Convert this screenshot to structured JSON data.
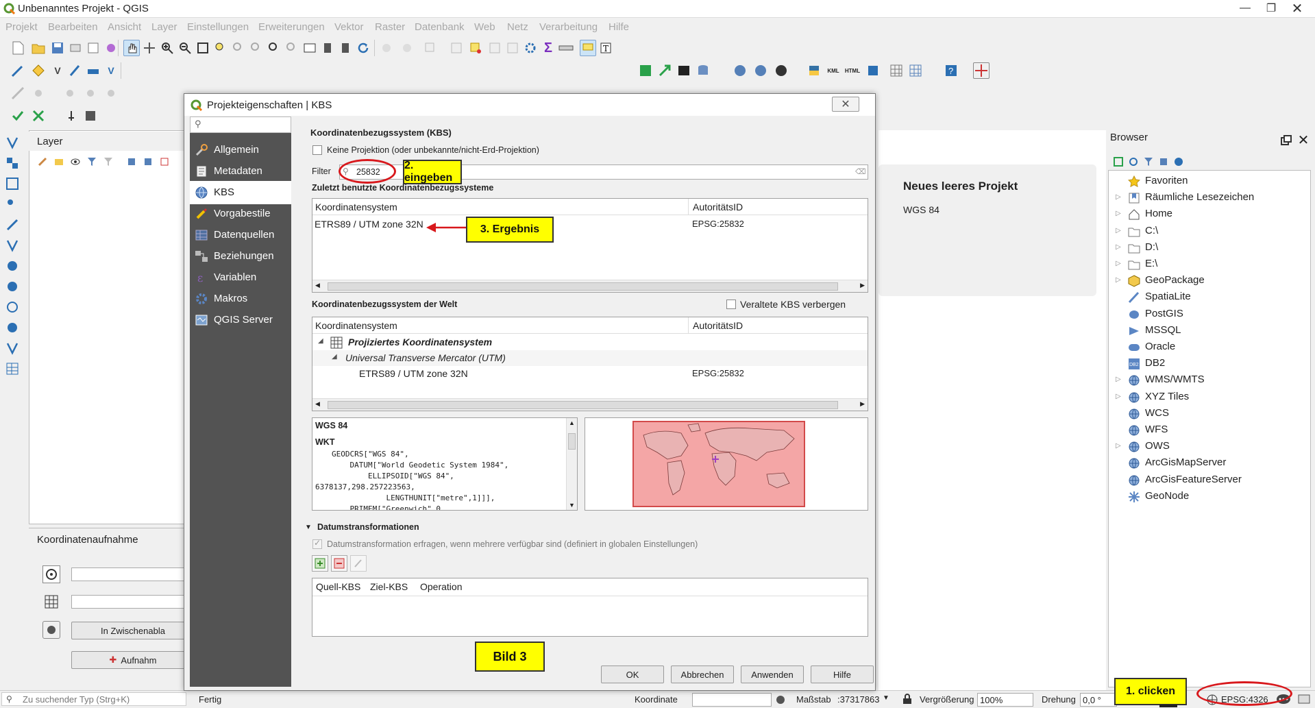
{
  "window": {
    "title": "Unbenanntes Projekt - QGIS",
    "controls": [
      "minimize",
      "restore",
      "close"
    ]
  },
  "menu": [
    "Projekt",
    "Bearbeiten",
    "Ansicht",
    "Layer",
    "Einstellungen",
    "Erweiterungen",
    "Vektor",
    "Raster",
    "Datenbank",
    "Web",
    "Netz",
    "Verarbeitung",
    "Hilfe"
  ],
  "layer_panel": {
    "title": "Layer"
  },
  "coord_panel": {
    "title": "Koordinatenaufnahme",
    "copy_button": "In Zwischenabla",
    "capture_button": "Aufnahm"
  },
  "welcome": {
    "title": "Neues leeres Projekt",
    "crs": "WGS 84"
  },
  "dialog": {
    "title": "Projekteigenschaften | KBS",
    "search_placeholder": "",
    "sidebar": [
      {
        "label": "Allgemein",
        "icon": "wrench-icon"
      },
      {
        "label": "Metadaten",
        "icon": "notepad-icon"
      },
      {
        "label": "KBS",
        "icon": "globe-icon",
        "selected": true
      },
      {
        "label": "Vorgabestile",
        "icon": "brush-icon"
      },
      {
        "label": "Datenquellen",
        "icon": "table-icon"
      },
      {
        "label": "Beziehungen",
        "icon": "relations-icon"
      },
      {
        "label": "Variablen",
        "icon": "epsilon-icon"
      },
      {
        "label": "Makros",
        "icon": "gear-icon"
      },
      {
        "label": "QGIS Server",
        "icon": "server-icon"
      }
    ],
    "section_title": "Koordinatenbezugssystem (KBS)",
    "no_projection_label": "Keine Projektion (oder unbekannte/nicht-Erd-Projektion)",
    "filter_label": "Filter",
    "filter_value": "25832",
    "recent_title": "Zuletzt benutzte Koordinatenbezugssysteme",
    "col_crs": "Koordinatensystem",
    "col_authority": "AutoritätsID",
    "recent_rows": [
      {
        "name": "ETRS89 / UTM zone 32N",
        "id": "EPSG:25832"
      }
    ],
    "world_title": "Koordinatenbezugssystem der Welt",
    "hide_deprecated": "Veraltete KBS verbergen",
    "tree_projected": "Projiziertes Koordinatensystem",
    "tree_utm": "Universal Transverse Mercator (UTM)",
    "tree_leaf": {
      "name": "ETRS89 / UTM zone 32N",
      "id": "EPSG:25832"
    },
    "wkt_title": "WGS 84",
    "wkt_label": "WKT",
    "wkt_lines": [
      "GEODCRS[\"WGS 84\",",
      "    DATUM[\"World Geodetic System 1984\",",
      "        ELLIPSOID[\"WGS 84\",",
      "6378137,298.257223563,",
      "            LENGTHUNIT[\"metre\",1]]],",
      "    PRIMEM[\"Greenwich\",0,"
    ],
    "datum_title": "Datumstransformationen",
    "datum_check": "Datumstransformation erfragen, wenn mehrere verfügbar sind (definiert in globalen Einstellungen)",
    "datum_cols": [
      "Quell-KBS",
      "Ziel-KBS",
      "Operation"
    ],
    "buttons": {
      "ok": "OK",
      "cancel": "Abbrechen",
      "apply": "Anwenden",
      "help": "Hilfe"
    }
  },
  "callouts": {
    "step1": "1. clicken",
    "step2": "2. eingeben",
    "step3": "3. Ergebnis",
    "figure": "Bild 3"
  },
  "browser": {
    "title": "Browser",
    "items": [
      {
        "label": "Favoriten",
        "icon": "star-icon",
        "expand": false
      },
      {
        "label": "Räumliche Lesezeichen",
        "icon": "bookmark-icon",
        "expand": true
      },
      {
        "label": "Home",
        "icon": "home-icon",
        "expand": true
      },
      {
        "label": "C:\\",
        "icon": "folder-icon",
        "expand": true
      },
      {
        "label": "D:\\",
        "icon": "folder-icon",
        "expand": true
      },
      {
        "label": "E:\\",
        "icon": "folder-icon",
        "expand": true
      },
      {
        "label": "GeoPackage",
        "icon": "geopackage-icon",
        "expand": true
      },
      {
        "label": "SpatiaLite",
        "icon": "feather-icon",
        "expand": false
      },
      {
        "label": "PostGIS",
        "icon": "elephant-icon",
        "expand": false
      },
      {
        "label": "MSSQL",
        "icon": "mssql-icon",
        "expand": false
      },
      {
        "label": "Oracle",
        "icon": "oracle-icon",
        "expand": false
      },
      {
        "label": "DB2",
        "icon": "db2-icon",
        "expand": false
      },
      {
        "label": "WMS/WMTS",
        "icon": "globe-icon",
        "expand": true
      },
      {
        "label": "XYZ Tiles",
        "icon": "globe-icon",
        "expand": true
      },
      {
        "label": "WCS",
        "icon": "globe-icon",
        "expand": false
      },
      {
        "label": "WFS",
        "icon": "globe-icon",
        "expand": false
      },
      {
        "label": "OWS",
        "icon": "globe-icon",
        "expand": true
      },
      {
        "label": "ArcGisMapServer",
        "icon": "globe-icon",
        "expand": false
      },
      {
        "label": "ArcGisFeatureServer",
        "icon": "globe-icon",
        "expand": false
      },
      {
        "label": "GeoNode",
        "icon": "geonode-icon",
        "expand": false
      }
    ]
  },
  "status": {
    "locator_placeholder": "Zu suchender Typ (Strg+K)",
    "ready": "Fertig",
    "coord_label": "Koordinate",
    "scale_label": "Maßstab",
    "scale_value": ":37317863",
    "zoom_label": "Vergrößerung",
    "zoom_value": "100%",
    "rotation_label": "Drehung",
    "rotation_value": "0,0 °",
    "crs": "EPSG:4326"
  },
  "colors": {
    "accent_red": "#d8181c",
    "callout_yellow": "#ffff00",
    "sidebar": "#535353"
  }
}
